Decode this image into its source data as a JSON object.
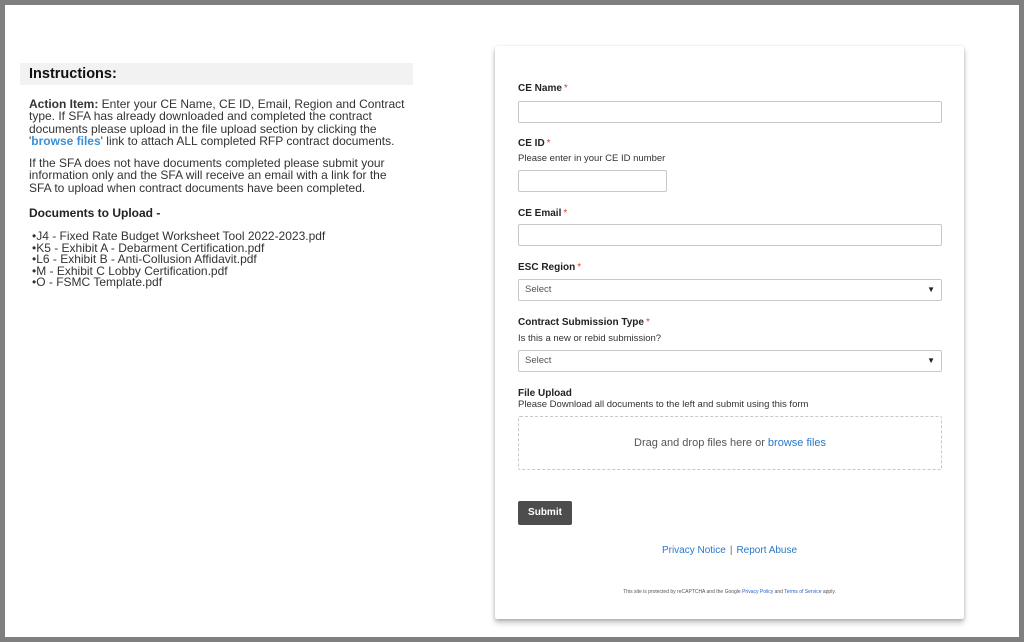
{
  "instructions": {
    "heading": "Instructions:",
    "action_bold": "Action Item:",
    "action_text_1": " Enter your CE Name, CE ID, Email, Region and Contract type. If SFA has already downloaded and completed the contract documents please upload in the file upload section by clicking the '",
    "browse_link": "browse files",
    "action_text_2": "' link to attach ALL completed RFP contract documents.",
    "paragraph_2": "If the SFA does not have documents completed please submit your information only and the SFA will receive an email with a link for the SFA to upload when contract documents have been completed.",
    "docs_heading": "Documents to Upload -",
    "documents": [
      "J4 - Fixed Rate Budget Worksheet Tool 2022-2023.pdf",
      "K5 - Exhibit A - Debarment Certification.pdf",
      "L6 - Exhibit B - Anti-Collusion Affidavit.pdf",
      "M - Exhibit C Lobby Certification.pdf",
      "O - FSMC Template.pdf"
    ]
  },
  "form": {
    "required_mark": "*",
    "ce_name": {
      "label": "CE Name",
      "value": ""
    },
    "ce_id": {
      "label": "CE ID",
      "help": "Please enter in your CE ID number",
      "value": ""
    },
    "ce_email": {
      "label": "CE Email",
      "value": ""
    },
    "esc_region": {
      "label": "ESC Region",
      "selected": "Select"
    },
    "contract_type": {
      "label": "Contract Submission Type",
      "help": "Is this a new or rebid submission?",
      "selected": "Select"
    },
    "file_upload": {
      "label": "File Upload",
      "help": "Please Download all documents to the left and submit using this form",
      "drop_text": "Drag and drop files here or ",
      "browse_link": "browse files"
    },
    "submit_label": "Submit",
    "privacy_link": "Privacy Notice",
    "separator": "|",
    "report_link": "Report Abuse",
    "recaptcha": {
      "text_1": "This site is protected by reCAPTCHA and the Google ",
      "privacy_policy": "Privacy Policy",
      "text_2": " and ",
      "terms": "Terms of Service",
      "text_3": " apply."
    }
  },
  "colors": {
    "accent_link": "#2a78c8",
    "required": "#e0443a",
    "submit_bg": "#4d4d4d",
    "frame": "#7f7f7f"
  }
}
